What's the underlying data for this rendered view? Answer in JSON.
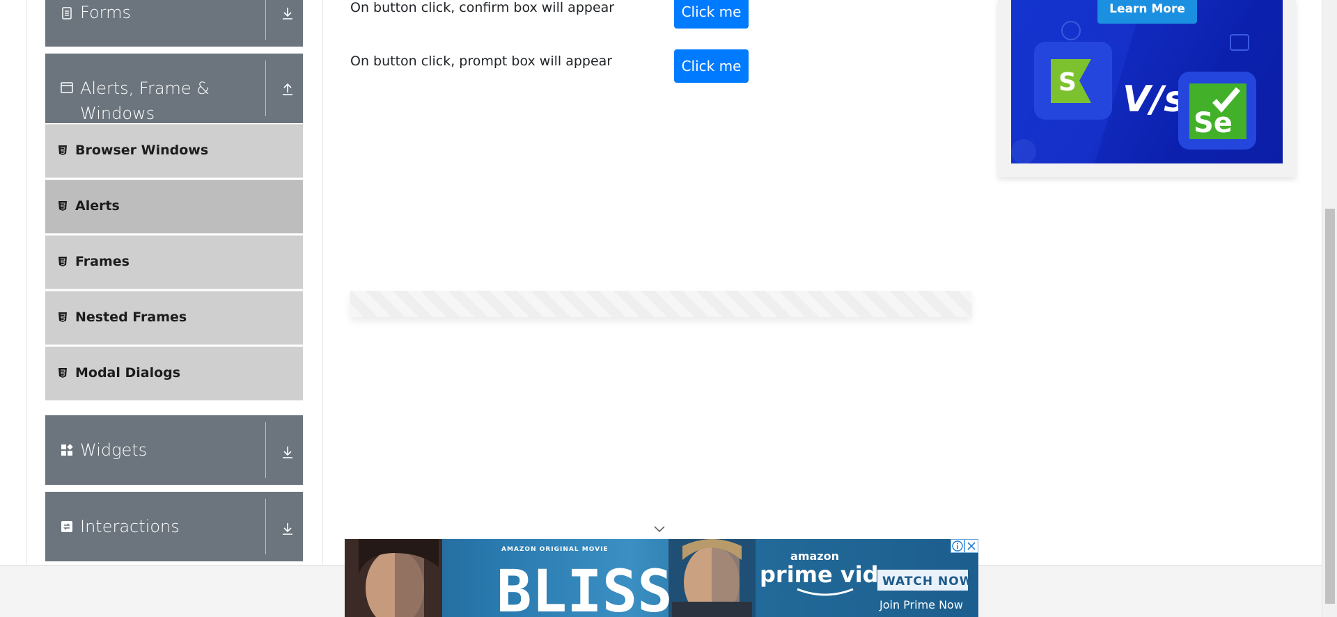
{
  "sidebar": {
    "forms": {
      "label": "Forms"
    },
    "alerts_group": {
      "label_line1": "Alerts, Frame &",
      "label_line2": "Windows"
    },
    "items": [
      {
        "label": "Browser Windows",
        "active": false
      },
      {
        "label": "Alerts",
        "active": true
      },
      {
        "label": "Frames",
        "active": false
      },
      {
        "label": "Nested Frames",
        "active": false
      },
      {
        "label": "Modal Dialogs",
        "active": false
      }
    ],
    "widgets": {
      "label": "Widgets"
    },
    "interactions": {
      "label": "Interactions"
    }
  },
  "main": {
    "confirm_row": {
      "text": "On button click, confirm box will appear",
      "button": "Click me"
    },
    "prompt_row": {
      "text": "On button click, prompt box will appear",
      "button": "Click me"
    }
  },
  "side_ad": {
    "cta": "Learn More",
    "vs_text": "V/s",
    "left_logo_letter": "S",
    "right_logo_text": "Se"
  },
  "bottom_ad": {
    "tagline": "AMAZON ORIGINAL MOVIE",
    "title": "BLISS",
    "brand_top": "amazon",
    "brand_main": "prime video",
    "cta": "WATCH NOW",
    "footer": "Join Prime Now",
    "footer_bold": "Prime"
  },
  "colors": {
    "sidebar_header": "#6c757d",
    "submenu_bg": "#cfcfcf",
    "submenu_active": "#bdbdbd",
    "button": "#007bff",
    "ad_blue": "#1434cf"
  }
}
